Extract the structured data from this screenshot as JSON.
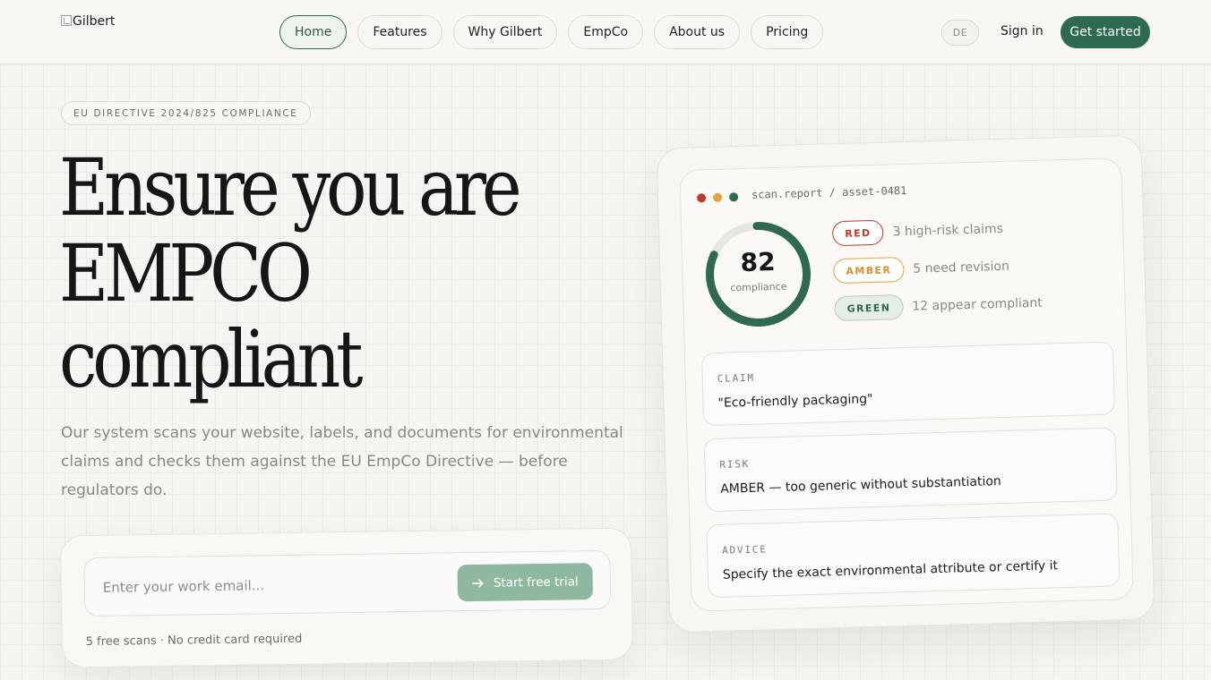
{
  "header": {
    "logo_alt": "Gilbert",
    "nav": [
      {
        "label": "Home",
        "active": true
      },
      {
        "label": "Features",
        "active": false
      },
      {
        "label": "Why Gilbert",
        "active": false
      },
      {
        "label": "EmpCo",
        "active": false
      },
      {
        "label": "About us",
        "active": false
      },
      {
        "label": "Pricing",
        "active": false
      }
    ],
    "language": "DE",
    "sign_in": "Sign in",
    "get_started": "Get started"
  },
  "hero": {
    "badge": "EU DIRECTIVE 2024/825 COMPLIANCE",
    "headline": [
      "Ensure you are",
      "EMPCO",
      "compliant"
    ],
    "subtext": "Our system scans your website, labels, and documents for environmental claims and checks them against the EU EmpCo Directive — before regulators do.",
    "email_placeholder": "Enter your work email...",
    "trial_button": "Start free trial",
    "fineprint": "5 free scans · No credit card required"
  },
  "report": {
    "window_dot_colors": [
      "#c0392b",
      "#e6a23c",
      "#2d6a4f"
    ],
    "filename": "scan.report / asset-0481",
    "score": "82",
    "score_value": 82,
    "score_max": 100,
    "score_label": "compliance",
    "legend": [
      {
        "pill": "RED",
        "text": "3 high-risk claims",
        "color": "#c0392b"
      },
      {
        "pill": "AMBER",
        "text": "5 need revision",
        "color": "#e6a23c"
      },
      {
        "pill": "GREEN",
        "text": "12 appear compliant",
        "color": "#2d6a4f"
      }
    ],
    "fields": [
      {
        "label": "CLAIM",
        "value": "\"Eco-friendly packaging\""
      },
      {
        "label": "RISK",
        "value": "AMBER — too generic without substantiation"
      },
      {
        "label": "ADVICE",
        "value": "Specify the exact environmental attribute or certify it"
      }
    ]
  },
  "colors": {
    "brand_green": "#2d6a4f",
    "trial_button": "#8fb8a2",
    "background": "#f6f5f1"
  }
}
